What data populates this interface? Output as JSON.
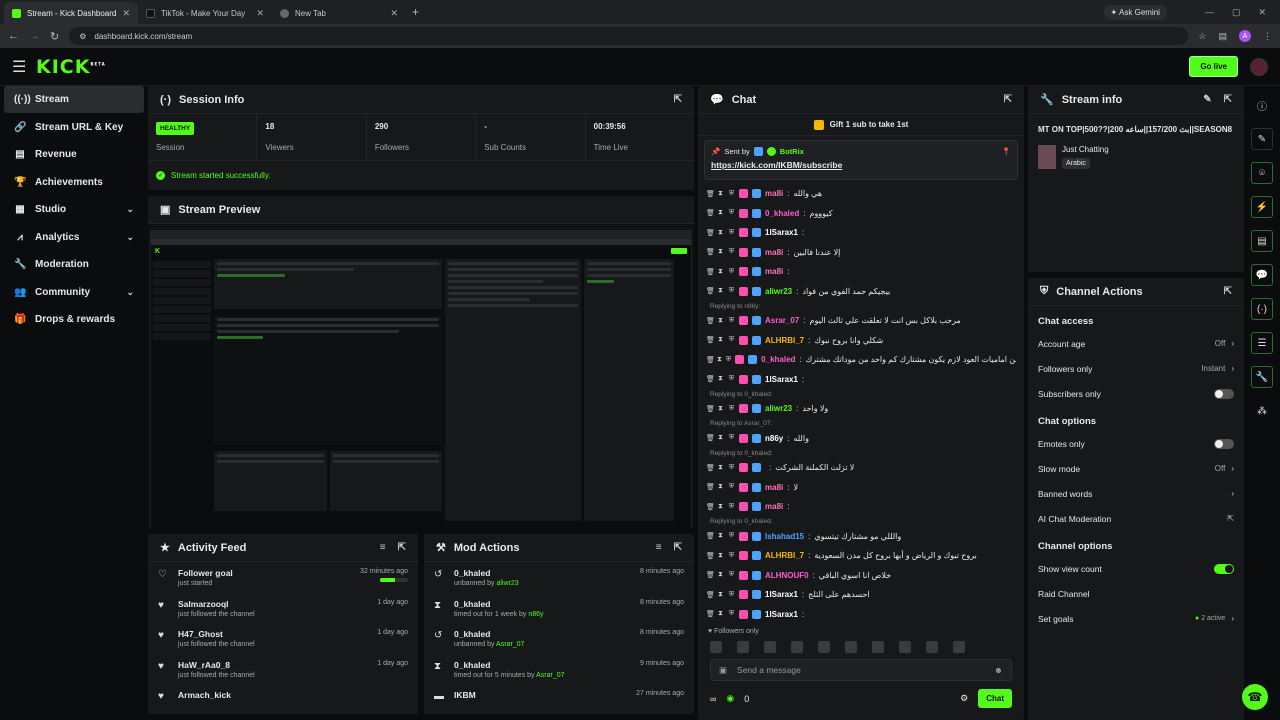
{
  "browser": {
    "tabs": [
      {
        "title": "Stream - Kick Dashboard",
        "color": "#53fc18"
      },
      {
        "title": "TikTok - Make Your Day",
        "color": "#111111"
      },
      {
        "title": "New Tab",
        "color": "#888888"
      }
    ],
    "gemini": "Ask Gemini",
    "url": "dashboard.kick.com/stream",
    "profile": "A"
  },
  "topbar": {
    "logo": "KICK",
    "logo_sup": "BETA",
    "go_live": "Go live"
  },
  "sidebar": {
    "items": [
      {
        "label": "Stream",
        "icon": "(·)"
      },
      {
        "label": "Stream URL & Key",
        "icon": "🔗"
      },
      {
        "label": "Revenue",
        "icon": "▤"
      },
      {
        "label": "Achievements",
        "icon": "🏆"
      },
      {
        "label": "Studio",
        "icon": "▦"
      },
      {
        "label": "Analytics",
        "icon": "📈"
      },
      {
        "label": "Moderation",
        "icon": "🔧"
      },
      {
        "label": "Community",
        "icon": "👥"
      },
      {
        "label": "Drops & rewards",
        "icon": "🎁"
      }
    ]
  },
  "session": {
    "title": "Session Info",
    "status": "HEALTHY",
    "stats": [
      {
        "label": "Session",
        "value": ""
      },
      {
        "label": "Viewers",
        "value": "18"
      },
      {
        "label": "Followers",
        "value": "290"
      },
      {
        "label": "Sub Counts",
        "value": "-"
      },
      {
        "label": "Time Live",
        "value": "00:39:56"
      }
    ],
    "success": "Stream started successfully."
  },
  "preview": {
    "title": "Stream Preview"
  },
  "activity": {
    "title": "Activity Feed",
    "items": [
      {
        "title": "Follower goal",
        "sub": "just started",
        "time": "32 minutes ago",
        "progress": 0.55
      },
      {
        "title": "Salmarzooql",
        "sub": "just followed the channel",
        "time": "1 day ago"
      },
      {
        "title": "H47_Ghost",
        "sub": "just followed the channel",
        "time": "1 day ago"
      },
      {
        "title": "HaW_rAa0_8",
        "sub": "just followed the channel",
        "time": "1 day ago"
      },
      {
        "title": "Armach_kick",
        "sub": "",
        "time": ""
      }
    ]
  },
  "modactions": {
    "title": "Mod Actions",
    "items": [
      {
        "title": "0_khaled",
        "action": "unbanned by",
        "by": "aliwr23",
        "time": "8 minutes ago",
        "icon": "↺"
      },
      {
        "title": "0_khaled",
        "action": "timed out for 1 week by",
        "by": "n86y",
        "time": "8 minutes ago",
        "icon": "⧗"
      },
      {
        "title": "0_khaled",
        "action": "unbanned by",
        "by": "Asrar_07",
        "time": "8 minutes ago",
        "icon": "↺"
      },
      {
        "title": "0_khaled",
        "action": "timed out for 5 minutes by",
        "by": "Asrar_07",
        "time": "9 minutes ago",
        "icon": "⧗"
      },
      {
        "title": "IKBM",
        "action": "",
        "by": "",
        "time": "27 minutes ago",
        "icon": "▬"
      }
    ]
  },
  "chat": {
    "title": "Chat",
    "gift": "Gift 1 sub to take 1st",
    "pinned_by_label": "Sent by",
    "pinned_by": "BotRix",
    "pinned_link": "https://kick.com/IKBM/subscribe",
    "messages": [
      {
        "user": "ma8i",
        "color": "#ff6fb5",
        "text": "هي والله"
      },
      {
        "user": "0_khaled",
        "color": "#ff5bd1",
        "text": "كيوووم"
      },
      {
        "user": "1lSarax1",
        "color": "#ffffff",
        "text": ""
      },
      {
        "user": "ma8i",
        "color": "#ff6fb5",
        "text": "إلا عندنا فالبين"
      },
      {
        "user": "ma8i",
        "color": "#ff6fb5",
        "text": ""
      },
      {
        "user": "aliwr23",
        "color": "#53fc18",
        "text": "بيجيكم حمد الفوي من فواد"
      },
      {
        "reply": "Replying to n86y:",
        "user": "Asrar_07",
        "color": "#ff5bd1",
        "text": "مرحب بلاكل بس انت لا تعلقت علي ثالث اليوم"
      },
      {
        "user": "ALHRBI_7",
        "color": "#f5b800",
        "text": "شكلي وانا بروح نبوك"
      },
      {
        "user": "0_khaled",
        "color": "#ff5bd1",
        "text": "من اماميات العود لازم يكون مشتارك كم واحد من موداتك مشترك"
      },
      {
        "user": "1lSarax1",
        "color": "#ffffff",
        "text": ""
      },
      {
        "reply": "Replying to 0_khaled:",
        "user": "aliwr23",
        "color": "#53fc18",
        "text": "ولا واحد"
      },
      {
        "reply": "Replying to Asrar_07:",
        "user": "n86y",
        "color": "#ffffff",
        "text": "والله"
      },
      {
        "reply": "Replying to 0_khaled:",
        "user": "",
        "color": "#ffffff",
        "text": "لا تزلت الكملنة الشركت"
      },
      {
        "user": "ma8i",
        "color": "#ff6fb5",
        "text": "لا"
      },
      {
        "user": "ma8i",
        "color": "#ff6fb5",
        "text": ""
      },
      {
        "reply": "Replying to 0_khaled:",
        "user": "Ishahad15",
        "color": "#4fa3ff",
        "text": "والللي مو مشتارك تيتسوي"
      },
      {
        "user": "ALHRBI_7",
        "color": "#f5b800",
        "text": "بروح تبوك و الرياض و أبها بروح كل مدن السعودية"
      },
      {
        "user": "ALHNOUF0",
        "color": "#ff5bd1",
        "text": "خلاص انا اسوي الباقي"
      },
      {
        "user": "1lSarax1",
        "color": "#ffffff",
        "text": "احسدهم علی الثلج"
      },
      {
        "user": "1lSarax1",
        "color": "#ffffff",
        "text": ""
      }
    ],
    "followers_only": "Followers only",
    "placeholder": "Send a message",
    "count": "0",
    "send": "Chat"
  },
  "streaminfo": {
    "title": "Stream info",
    "stream_title": "MT ON TOP|500??|200 بث 157/200||ساعه||SEASON8",
    "category": "Just Chatting",
    "language": "Arabic"
  },
  "channel": {
    "title": "Channel Actions",
    "chat_access": "Chat access",
    "account_age": "Account age",
    "account_age_val": "Off",
    "followers_only": "Followers only",
    "followers_only_val": "Instant",
    "subscribers_only": "Subscribers only",
    "chat_options": "Chat options",
    "emotes_only": "Emotes only",
    "slow_mode": "Slow mode",
    "slow_mode_val": "Off",
    "banned_words": "Banned words",
    "ai_mod": "AI Chat Moderation",
    "channel_options": "Channel options",
    "show_view_count": "Show view count",
    "raid": "Raid Channel",
    "set_goals": "Set goals",
    "set_goals_val": "2 active"
  }
}
